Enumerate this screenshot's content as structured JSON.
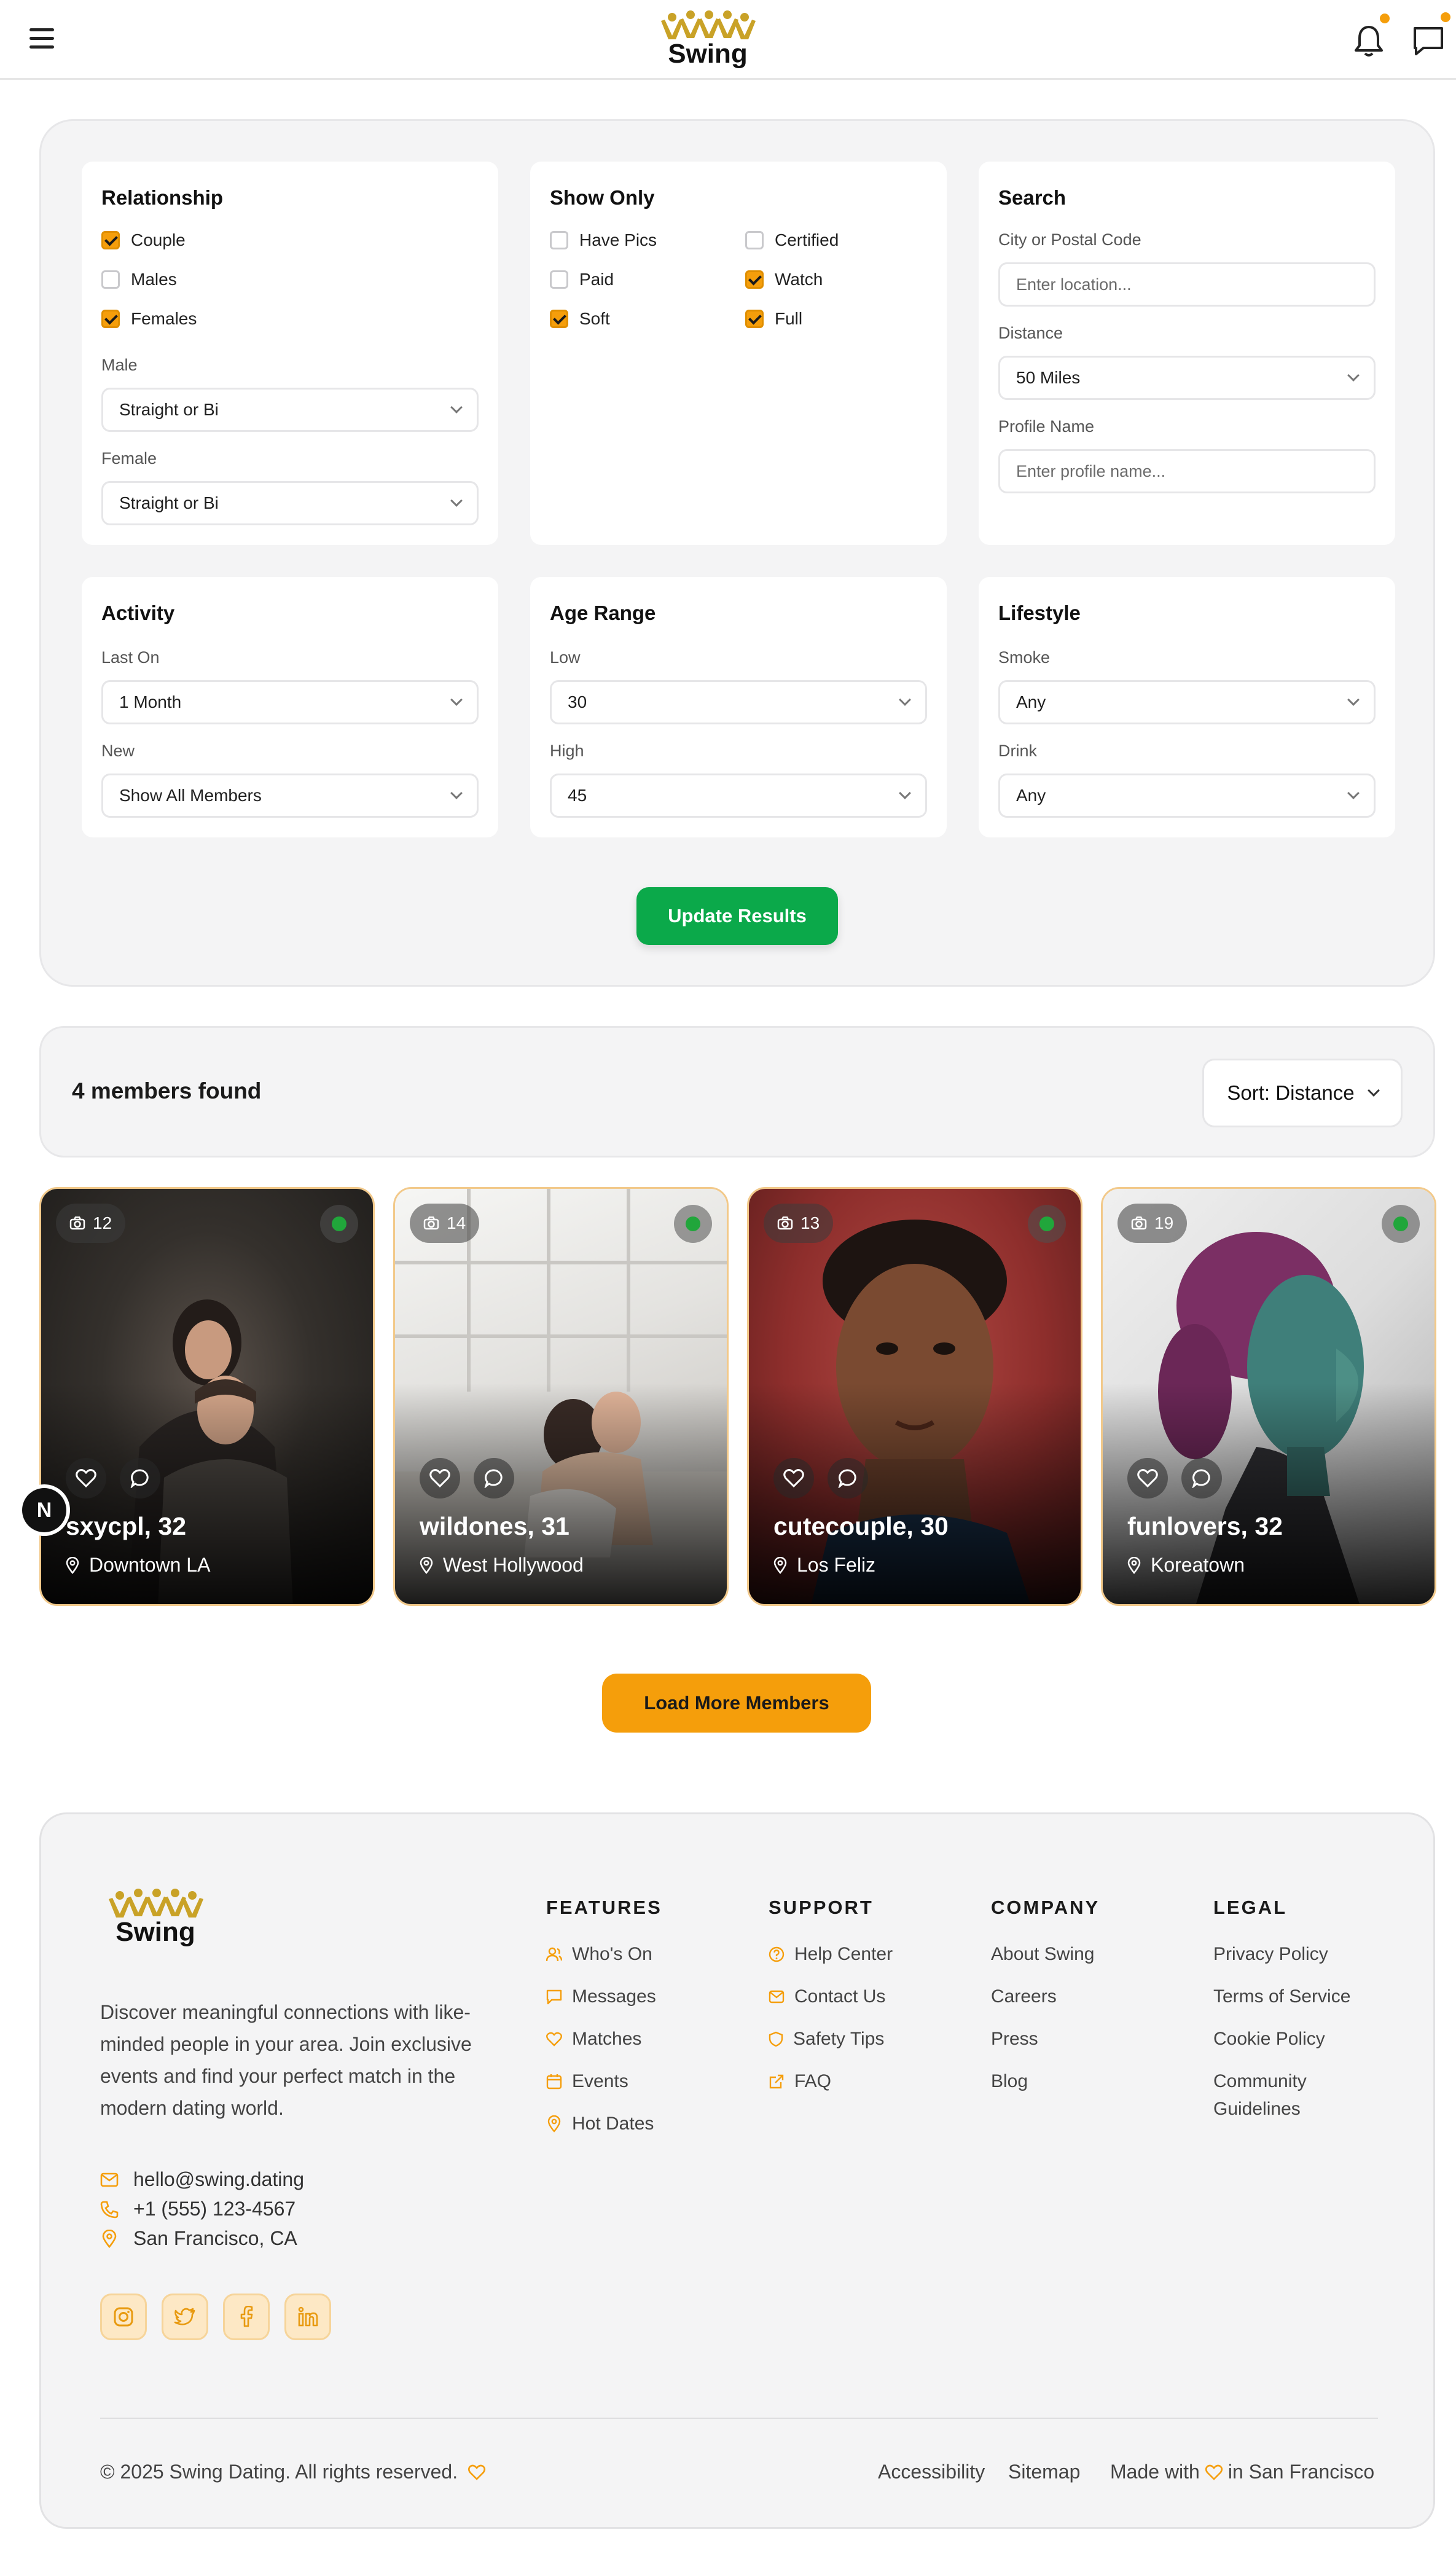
{
  "colors": {
    "accent": "#f59e0b",
    "green": "#0ba94a",
    "online": "#21a63b"
  },
  "brand": {
    "name": "Swing"
  },
  "header": {
    "menu_icon": "hamburger-icon",
    "notification_icon": "bell-icon",
    "messages_icon": "chat-icon"
  },
  "filters": {
    "relationship": {
      "title": "Relationship",
      "options": [
        {
          "label": "Couple",
          "checked": true
        },
        {
          "label": "Males",
          "checked": false
        },
        {
          "label": "Females",
          "checked": true
        }
      ],
      "male_label": "Male",
      "male_value": "Straight or Bi",
      "female_label": "Female",
      "female_value": "Straight or Bi"
    },
    "show_only": {
      "title": "Show Only",
      "options": [
        {
          "label": "Have Pics",
          "checked": false
        },
        {
          "label": "Certified",
          "checked": false
        },
        {
          "label": "Paid",
          "checked": false
        },
        {
          "label": "Watch",
          "checked": true
        },
        {
          "label": "Soft",
          "checked": true
        },
        {
          "label": "Full",
          "checked": true
        }
      ]
    },
    "search": {
      "title": "Search",
      "city_label": "City or Postal Code",
      "city_placeholder": "Enter location...",
      "distance_label": "Distance",
      "distance_value": "50 Miles",
      "profile_label": "Profile Name",
      "profile_placeholder": "Enter profile name..."
    },
    "activity": {
      "title": "Activity",
      "last_on_label": "Last On",
      "last_on_value": "1 Month",
      "new_label": "New",
      "new_value": "Show All Members"
    },
    "age_range": {
      "title": "Age Range",
      "low_label": "Low",
      "low_value": "30",
      "high_label": "High",
      "high_value": "45"
    },
    "lifestyle": {
      "title": "Lifestyle",
      "smoke_label": "Smoke",
      "smoke_value": "Any",
      "drink_label": "Drink",
      "drink_value": "Any"
    },
    "update_label": "Update Results"
  },
  "results": {
    "count_text": "4 members found",
    "sort_label": "Sort: Distance"
  },
  "members": [
    {
      "name": "sxycpl, 32",
      "location": "Downtown LA",
      "photos": "12",
      "online": true
    },
    {
      "name": "wildones, 31",
      "location": "West Hollywood",
      "photos": "14",
      "online": true
    },
    {
      "name": "cutecouple, 30",
      "location": "Los Feliz",
      "photos": "13",
      "online": true
    },
    {
      "name": "funlovers, 32",
      "location": "Koreatown",
      "photos": "19",
      "online": true
    }
  ],
  "floating_badge": "N",
  "load_more_label": "Load More Members",
  "footer": {
    "description": "Discover meaningful connections with like-minded people in your area. Join exclusive events and find your perfect match in the modern dating world.",
    "email": "hello@swing.dating",
    "phone": "+1 (555) 123-4567",
    "address": "San Francisco, CA",
    "social": [
      "instagram-icon",
      "twitter-icon",
      "facebook-icon",
      "linkedin-icon"
    ],
    "features": {
      "title": "FEATURES",
      "links": [
        "Who's On",
        "Messages",
        "Matches",
        "Events",
        "Hot Dates"
      ]
    },
    "support": {
      "title": "SUPPORT",
      "links": [
        "Help Center",
        "Contact Us",
        "Safety Tips",
        "FAQ"
      ]
    },
    "company": {
      "title": "COMPANY",
      "links": [
        "About Swing",
        "Careers",
        "Press",
        "Blog"
      ]
    },
    "legal": {
      "title": "LEGAL",
      "links": [
        "Privacy Policy",
        "Terms of Service",
        "Cookie Policy",
        "Community",
        "Guidelines"
      ]
    },
    "copyright": "© 2025 Swing Dating. All rights reserved.",
    "accessibility": "Accessibility",
    "sitemap": "Sitemap",
    "made_with": "Made with",
    "made_in": "in San Francisco"
  }
}
